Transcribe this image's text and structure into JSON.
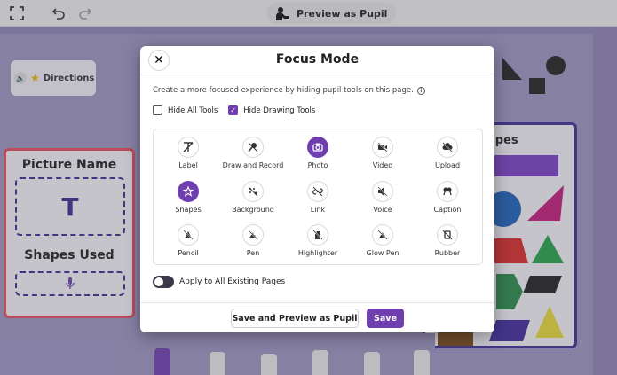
{
  "topbar": {
    "preview_label": "Preview as Pupil",
    "icons": [
      "fullscreen-icon",
      "undo-icon",
      "redo-icon",
      "pupil-icon"
    ]
  },
  "canvas": {
    "directions_label": "Directions",
    "picture_card_title": "Picture Name",
    "picture_card_letter": "T",
    "shapes_used_title": "Shapes Used",
    "shapes_card_title": "apes"
  },
  "modal": {
    "title": "Focus Mode",
    "close_label": "✕",
    "description": "Create a more focused experience by hiding pupil tools on this page.",
    "checkboxes": [
      {
        "label": "Hide All Tools",
        "checked": false
      },
      {
        "label": "Hide Drawing Tools",
        "checked": true
      }
    ],
    "tools": [
      {
        "label": "Label",
        "icon": "label-icon",
        "active": false
      },
      {
        "label": "Draw and Record",
        "icon": "draw-record-icon",
        "active": false
      },
      {
        "label": "Photo",
        "icon": "camera-icon",
        "active": true
      },
      {
        "label": "Video",
        "icon": "video-off-icon",
        "active": false
      },
      {
        "label": "Upload",
        "icon": "upload-off-icon",
        "active": false
      },
      {
        "label": "Shapes",
        "icon": "shapes-icon",
        "active": true
      },
      {
        "label": "Background",
        "icon": "background-off-icon",
        "active": false
      },
      {
        "label": "Link",
        "icon": "link-off-icon",
        "active": false
      },
      {
        "label": "Voice",
        "icon": "voice-off-icon",
        "active": false
      },
      {
        "label": "Caption",
        "icon": "caption-off-icon",
        "active": false
      },
      {
        "label": "Pencil",
        "icon": "pencil-off-icon",
        "active": false
      },
      {
        "label": "Pen",
        "icon": "pen-off-icon",
        "active": false
      },
      {
        "label": "Highlighter",
        "icon": "highlighter-off-icon",
        "active": false
      },
      {
        "label": "Glow Pen",
        "icon": "glow-pen-off-icon",
        "active": false
      },
      {
        "label": "Rubber",
        "icon": "rubber-off-icon",
        "active": false
      }
    ],
    "apply_label": "Apply to All Existing Pages",
    "apply_on": false,
    "save_preview_label": "Save and Preview as Pupil",
    "save_label": "Save"
  },
  "colors": {
    "accent": "#6f3fb0",
    "canvas": "#9b93c0",
    "card_border_red": "#e34b5c",
    "card_border_navy": "#3d2f91"
  }
}
